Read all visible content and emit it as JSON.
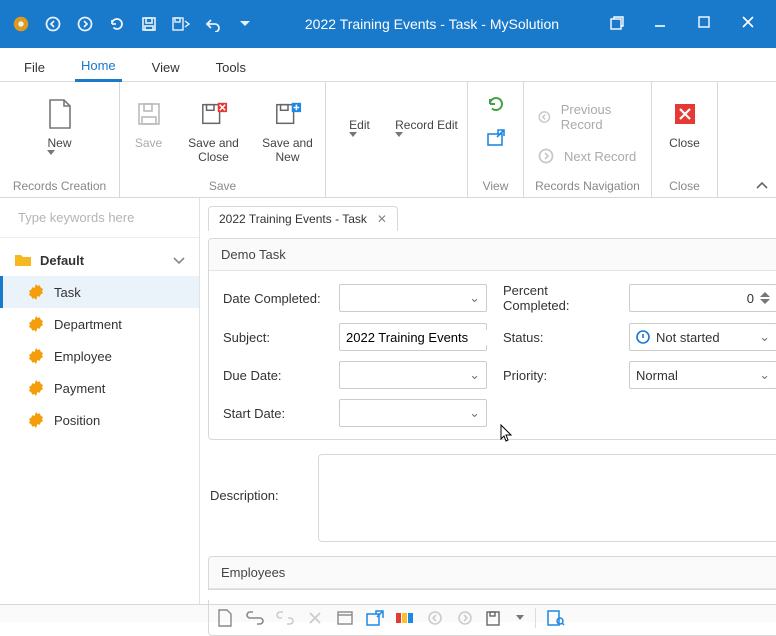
{
  "titlebar": {
    "title": "2022 Training Events - Task - MySolution"
  },
  "menu": {
    "file": "File",
    "home": "Home",
    "view": "View",
    "tools": "Tools"
  },
  "ribbon": {
    "new": "New",
    "save": "Save",
    "save_close": "Save and Close",
    "save_new": "Save and New",
    "edit": "Edit",
    "record_edit": "Record Edit",
    "close": "Close",
    "prev": "Previous Record",
    "next": "Next Record",
    "g_records": "Records Creation",
    "g_save": "Save",
    "g_view": "View",
    "g_nav": "Records Navigation",
    "g_close": "Close"
  },
  "search": {
    "placeholder": "Type keywords here"
  },
  "tree": {
    "root": "Default",
    "items": [
      "Task",
      "Department",
      "Employee",
      "Payment",
      "Position"
    ]
  },
  "doc_tab": {
    "title": "2022 Training Events - Task"
  },
  "panel": {
    "title": "Demo Task",
    "date_completed": "Date Completed:",
    "percent_completed": "Percent Completed:",
    "percent_value": "0",
    "subject": "Subject:",
    "subject_value": "2022 Training Events",
    "status": "Status:",
    "status_value": "Not started",
    "due_date": "Due Date:",
    "priority": "Priority:",
    "priority_value": "Normal",
    "start_date": "Start Date:"
  },
  "description_label": "Description:",
  "employees_panel": "Employees"
}
